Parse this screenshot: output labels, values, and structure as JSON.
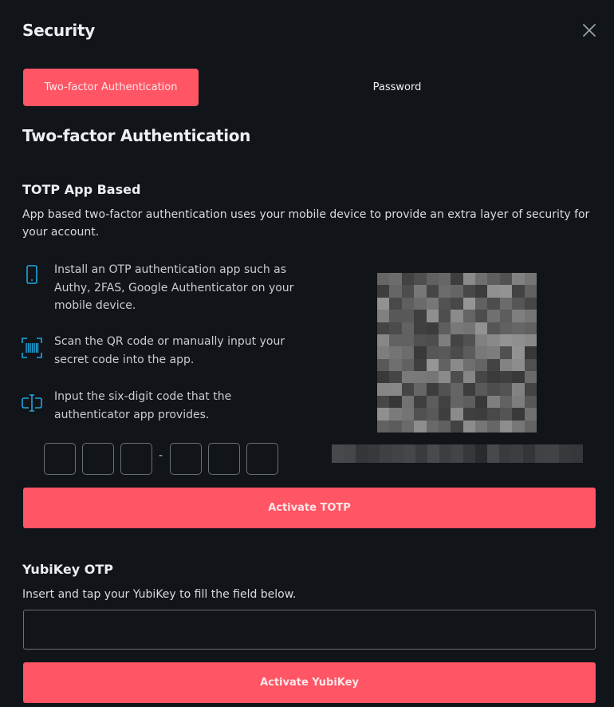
{
  "header": {
    "title": "Security"
  },
  "tabs": [
    {
      "label": "Two-factor Authentication",
      "active": true
    },
    {
      "label": "Password",
      "active": false
    }
  ],
  "section": {
    "title": "Two-factor Authentication"
  },
  "totp": {
    "title": "TOTP App Based",
    "description": "App based two-factor authentication uses your mobile device to provide an extra layer of security for your account.",
    "steps": [
      {
        "icon": "mobile-phone-icon",
        "text": "Install an OTP authentication app such as Authy, 2FAS, Google Authenticator on your mobile device."
      },
      {
        "icon": "barcode-scan-icon",
        "text": "Scan the QR code or manually input your secret code into the app."
      },
      {
        "icon": "text-cursor-input-icon",
        "text": "Input the six-digit code that the authenticator app provides."
      }
    ],
    "code_separator": "-",
    "code_digits": [
      "",
      "",
      "",
      "",
      "",
      ""
    ],
    "activate_label": "Activate TOTP"
  },
  "yubikey": {
    "title": "YubiKey OTP",
    "description": "Insert and tap your YubiKey to fill the field below.",
    "input_value": "",
    "activate_label": "Activate YubiKey"
  },
  "colors": {
    "background": "#111419",
    "accent": "#ff5564",
    "icon_accent": "#1ea8e0",
    "border": "#6b6f76"
  }
}
